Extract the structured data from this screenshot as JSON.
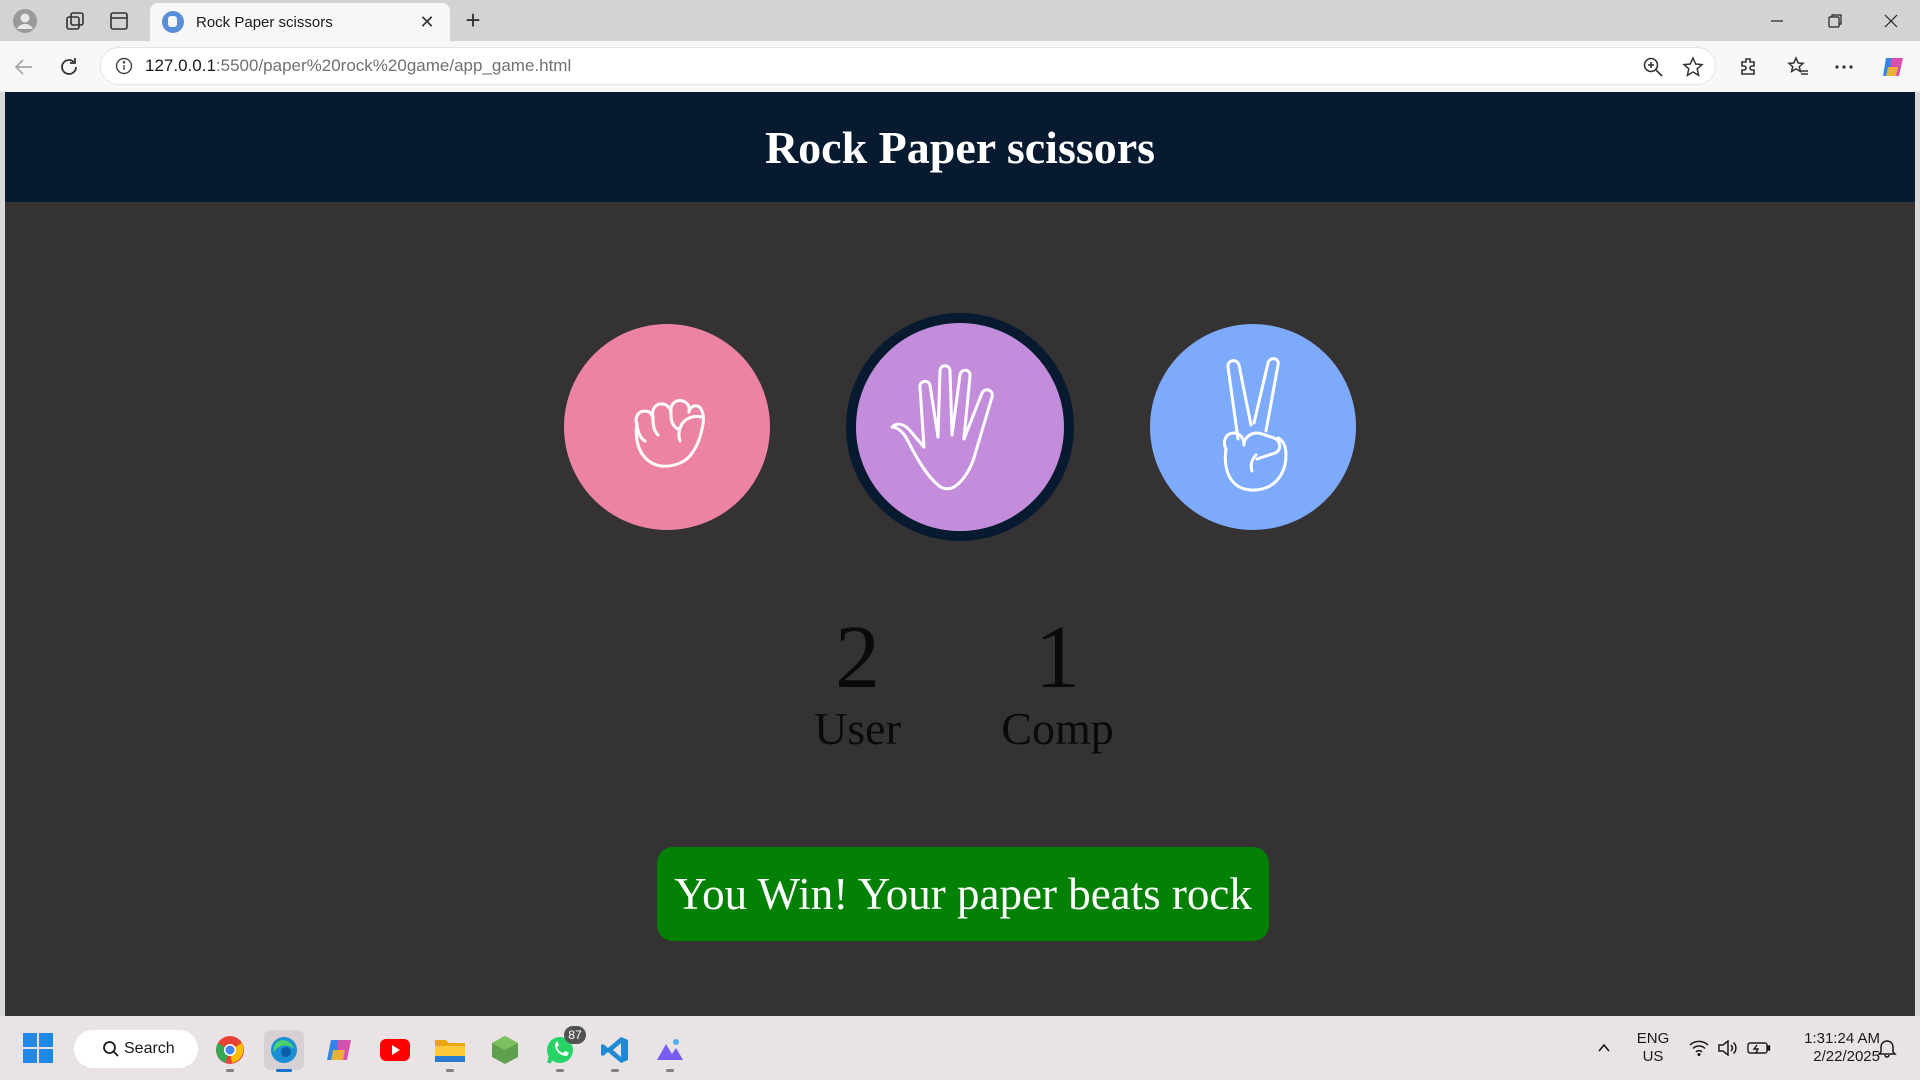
{
  "browser": {
    "tab_title": "Rock Paper scissors",
    "url_host": "127.0.0.1",
    "url_path": ":5500/paper%20rock%20game/app_game.html"
  },
  "page": {
    "title": "Rock Paper scissors",
    "choices": [
      {
        "name": "rock",
        "icon": "fist-icon",
        "color": "#ed83a3"
      },
      {
        "name": "paper",
        "icon": "open-hand-icon",
        "color": "#c38ddb",
        "selected": true
      },
      {
        "name": "scissors",
        "icon": "peace-sign-icon",
        "color": "#7eaafb"
      }
    ],
    "score": {
      "user": "2",
      "user_label": "User",
      "comp": "1",
      "comp_label": "Comp"
    },
    "message": "You Win! Your paper beats rock",
    "message_color": "#028104"
  },
  "taskbar": {
    "search_label": "Search",
    "whatsapp_badge": "87",
    "language": "ENG",
    "region": "US",
    "time": "1:31:24 AM",
    "date": "2/22/2025"
  }
}
